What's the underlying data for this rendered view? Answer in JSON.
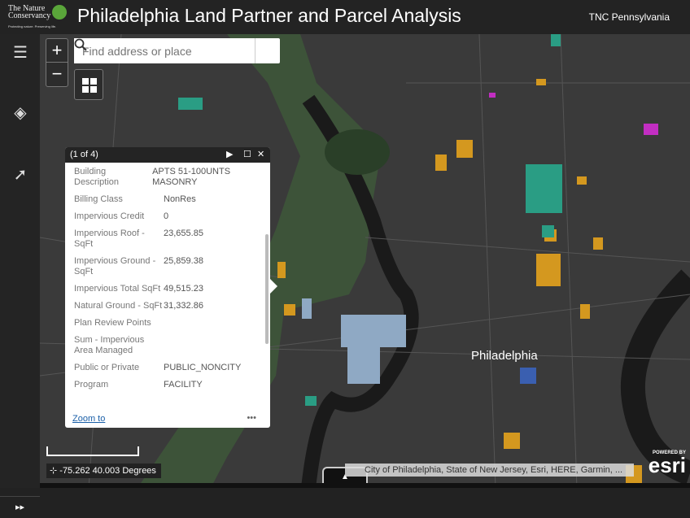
{
  "header": {
    "logo_text": "The Nature Conservancy",
    "logo_tagline": "Protecting nature. Preserving life.",
    "title": "Philadelphia Land Partner and Parcel Analysis",
    "org": "TNC Pennsylvania"
  },
  "sidebar": {
    "items": [
      {
        "icon": "legend-list-icon"
      },
      {
        "icon": "layers-icon"
      },
      {
        "icon": "select-tool-icon"
      }
    ],
    "expand": "▸▸"
  },
  "map": {
    "zoom_in": "+",
    "zoom_out": "−",
    "search_placeholder": "Find address or place",
    "city_label": "Philadelphia",
    "coordinates": "-75.262 40.003 Degrees",
    "attribution": "City of Philadelphia, State of New Jersey, Esri, HERE, Garmin, ...",
    "powered_by": "POWERED BY",
    "esri": "esri",
    "toggle": "▲"
  },
  "popup": {
    "counter": "(1 of 4)",
    "zoom_to": "Zoom to",
    "more": "•••",
    "fields": [
      {
        "label": "Building Description",
        "value": "APTS 51-100UNTS MASONRY"
      },
      {
        "label": "Billing Class",
        "value": "NonRes"
      },
      {
        "label": "Impervious Credit",
        "value": "0"
      },
      {
        "label": "Impervious Roof - SqFt",
        "value": "23,655.85"
      },
      {
        "label": "Impervious Ground - SqFt",
        "value": "25,859.38"
      },
      {
        "label": "Impervious Total SqFt",
        "value": "49,515.23"
      },
      {
        "label": "Natural Ground - SqFt",
        "value": "31,332.86"
      },
      {
        "label": "Plan Review Points",
        "value": ""
      },
      {
        "label": "Sum - Impervious Area Managed",
        "value": ""
      },
      {
        "label": "Public or Private",
        "value": "PUBLIC_NONCITY"
      },
      {
        "label": "Program",
        "value": "FACILITY"
      }
    ]
  },
  "colors": {
    "parcel_orange": "#d4981f",
    "parcel_teal": "#2a9d84",
    "parcel_blue": "#8fa9c4",
    "parcel_magenta": "#c22ec2",
    "park": "#3e5a3a",
    "river": "#1a1a1a"
  }
}
